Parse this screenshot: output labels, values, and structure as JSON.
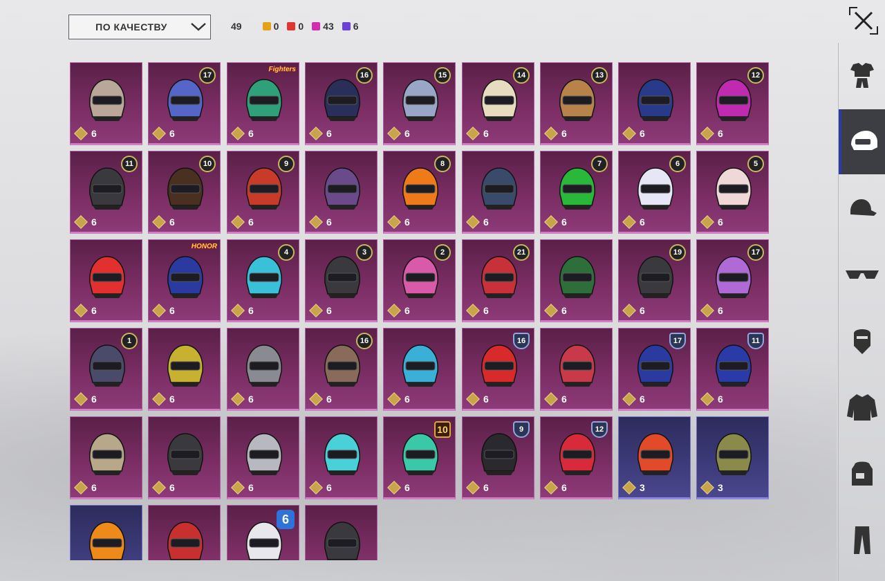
{
  "toolbar": {
    "sort_label": "ПО КАЧЕСТВУ",
    "total": "49",
    "counts": [
      {
        "value": "0",
        "color": "#e5a219"
      },
      {
        "value": "0",
        "color": "#e03530"
      },
      {
        "value": "43",
        "color": "#d42cb0"
      },
      {
        "value": "6",
        "color": "#6b3fd8"
      }
    ]
  },
  "sidebar": {
    "items": [
      {
        "icon": "outfit-icon",
        "active": false
      },
      {
        "icon": "helmet-icon",
        "active": true
      },
      {
        "icon": "cap-icon",
        "active": false
      },
      {
        "icon": "glasses-icon",
        "active": false
      },
      {
        "icon": "mask-icon",
        "active": false
      },
      {
        "icon": "jacket-icon",
        "active": false
      },
      {
        "icon": "backpack-icon",
        "active": false
      },
      {
        "icon": "pants-icon",
        "active": false
      }
    ]
  },
  "helmets": [
    {
      "qty": "6",
      "level": "",
      "badge": "",
      "color": "#b9a89a",
      "rarity": "purple"
    },
    {
      "qty": "6",
      "level": "17",
      "badge": "circle",
      "color": "#5566c8",
      "rarity": "purple"
    },
    {
      "qty": "6",
      "level": "",
      "badge": "",
      "color": "#2fa07a",
      "rarity": "purple",
      "logo": "Fighters"
    },
    {
      "qty": "6",
      "level": "16",
      "badge": "circle",
      "color": "#2a2f5a",
      "rarity": "purple"
    },
    {
      "qty": "6",
      "level": "15",
      "badge": "circle",
      "color": "#9aa6c8",
      "rarity": "purple"
    },
    {
      "qty": "6",
      "level": "14",
      "badge": "circle",
      "color": "#e8dcc0",
      "rarity": "purple"
    },
    {
      "qty": "6",
      "level": "13",
      "badge": "circle",
      "color": "#b8834a",
      "rarity": "purple"
    },
    {
      "qty": "6",
      "level": "",
      "badge": "",
      "color": "#2a3a8a",
      "rarity": "purple"
    },
    {
      "qty": "6",
      "level": "12",
      "badge": "circle",
      "color": "#c02ab0",
      "rarity": "purple"
    },
    {
      "qty": "6",
      "level": "11",
      "badge": "circle",
      "color": "#3a3a3e",
      "rarity": "purple"
    },
    {
      "qty": "6",
      "level": "10",
      "badge": "circle",
      "color": "#4a3020",
      "rarity": "purple"
    },
    {
      "qty": "6",
      "level": "9",
      "badge": "circle",
      "color": "#c83a2a",
      "rarity": "purple"
    },
    {
      "qty": "6",
      "level": "",
      "badge": "",
      "color": "#6a4a8a",
      "rarity": "purple"
    },
    {
      "qty": "6",
      "level": "8",
      "badge": "circle",
      "color": "#ee7a1a",
      "rarity": "purple"
    },
    {
      "qty": "6",
      "level": "",
      "badge": "",
      "color": "#3a4a6a",
      "rarity": "purple"
    },
    {
      "qty": "6",
      "level": "7",
      "badge": "circle",
      "color": "#2ab83a",
      "rarity": "purple"
    },
    {
      "qty": "6",
      "level": "6",
      "badge": "circle",
      "color": "#e6e6f6",
      "rarity": "purple"
    },
    {
      "qty": "6",
      "level": "5",
      "badge": "circle",
      "color": "#f0d8d8",
      "rarity": "purple"
    },
    {
      "qty": "6",
      "level": "",
      "badge": "",
      "color": "#e23030",
      "rarity": "purple"
    },
    {
      "qty": "6",
      "level": "",
      "badge": "",
      "color": "#2a3aa0",
      "rarity": "purple",
      "logo": "HONOR"
    },
    {
      "qty": "6",
      "level": "4",
      "badge": "circle",
      "color": "#3ac0d8",
      "rarity": "purple"
    },
    {
      "qty": "6",
      "level": "3",
      "badge": "circle",
      "color": "#3a3a3e",
      "rarity": "purple"
    },
    {
      "qty": "6",
      "level": "2",
      "badge": "circle",
      "color": "#d85aa8",
      "rarity": "purple"
    },
    {
      "qty": "6",
      "level": "21",
      "badge": "circle",
      "color": "#c8303a",
      "rarity": "purple"
    },
    {
      "qty": "6",
      "level": "",
      "badge": "",
      "color": "#2e6e3a",
      "rarity": "purple"
    },
    {
      "qty": "6",
      "level": "19",
      "badge": "circle",
      "color": "#3a3a3e",
      "rarity": "purple"
    },
    {
      "qty": "6",
      "level": "17",
      "badge": "circle",
      "color": "#b06ad8",
      "rarity": "purple"
    },
    {
      "qty": "6",
      "level": "1",
      "badge": "circle",
      "color": "#4a4a6a",
      "rarity": "purple"
    },
    {
      "qty": "6",
      "level": "",
      "badge": "",
      "color": "#c8b030",
      "rarity": "purple"
    },
    {
      "qty": "6",
      "level": "",
      "badge": "",
      "color": "#8a8a92",
      "rarity": "purple"
    },
    {
      "qty": "6",
      "level": "16",
      "badge": "circle",
      "color": "#8a6a5a",
      "rarity": "purple"
    },
    {
      "qty": "6",
      "level": "",
      "badge": "",
      "color": "#3ab0d8",
      "rarity": "purple"
    },
    {
      "qty": "6",
      "level": "16",
      "badge": "shield",
      "color": "#d82a2a",
      "rarity": "purple"
    },
    {
      "qty": "6",
      "level": "",
      "badge": "",
      "color": "#c83a4a",
      "rarity": "purple"
    },
    {
      "qty": "6",
      "level": "17",
      "badge": "shield",
      "color": "#2a3aa0",
      "rarity": "purple"
    },
    {
      "qty": "6",
      "level": "11",
      "badge": "shield",
      "color": "#2a3aa8",
      "rarity": "purple"
    },
    {
      "qty": "6",
      "level": "",
      "badge": "",
      "color": "#b8a88a",
      "rarity": "purple"
    },
    {
      "qty": "6",
      "level": "",
      "badge": "",
      "color": "#3a3a3e",
      "rarity": "purple"
    },
    {
      "qty": "6",
      "level": "",
      "badge": "",
      "color": "#b8b8c0",
      "rarity": "purple"
    },
    {
      "qty": "6",
      "level": "",
      "badge": "",
      "color": "#4ad0d8",
      "rarity": "purple"
    },
    {
      "qty": "6",
      "level": "10",
      "badge": "gold",
      "color": "#3ac8a8",
      "rarity": "purple"
    },
    {
      "qty": "6",
      "level": "9",
      "badge": "shield",
      "color": "#2a2a2e",
      "rarity": "purple"
    },
    {
      "qty": "6",
      "level": "12",
      "badge": "shield",
      "color": "#d82a3a",
      "rarity": "purple"
    },
    {
      "qty": "3",
      "level": "",
      "badge": "",
      "color": "#e24a2a",
      "rarity": "blue"
    },
    {
      "qty": "3",
      "level": "",
      "badge": "",
      "color": "#8a8a4a",
      "rarity": "blue"
    },
    {
      "qty": "",
      "level": "",
      "badge": "",
      "color": "#ee8a1a",
      "rarity": "blue"
    },
    {
      "qty": "",
      "level": "",
      "badge": "",
      "color": "#c83030",
      "rarity": "purple"
    },
    {
      "qty": "",
      "level": "6",
      "badge": "blue6",
      "color": "#e8e8ec",
      "rarity": "purple"
    },
    {
      "qty": "",
      "level": "",
      "badge": "",
      "color": "#3a3a3e",
      "rarity": "purple"
    }
  ]
}
